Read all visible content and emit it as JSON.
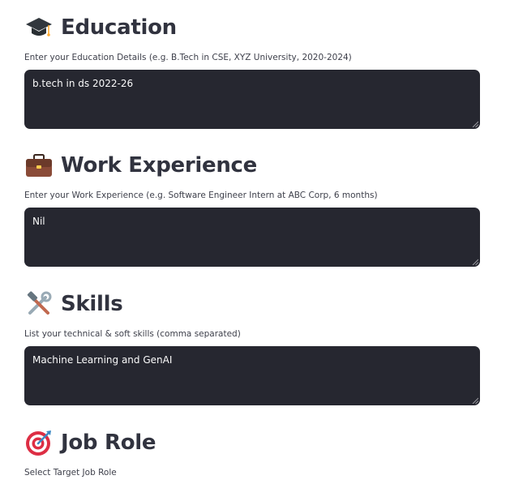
{
  "sections": {
    "education": {
      "icon": "graduation-cap-icon",
      "title": "Education",
      "label": "Enter your Education Details (e.g. B.Tech in CSE, XYZ University, 2020-2024)",
      "value": "b.tech in ds 2022-26"
    },
    "work": {
      "icon": "briefcase-icon",
      "title": "Work Experience",
      "label": "Enter your Work Experience (e.g. Software Engineer Intern at ABC Corp, 6 months)",
      "value": "Nil"
    },
    "skills": {
      "icon": "hammer-wrench-icon",
      "title": "Skills",
      "label": "List your technical & soft skills (comma separated)",
      "value": "Machine Learning and GenAI"
    },
    "job_role": {
      "icon": "direct-hit-target-icon",
      "title": "Job Role",
      "label": "Select Target Job Role"
    }
  },
  "colors": {
    "input_bg": "#262730",
    "input_text": "#fafafa",
    "heading_text": "#31333f"
  }
}
